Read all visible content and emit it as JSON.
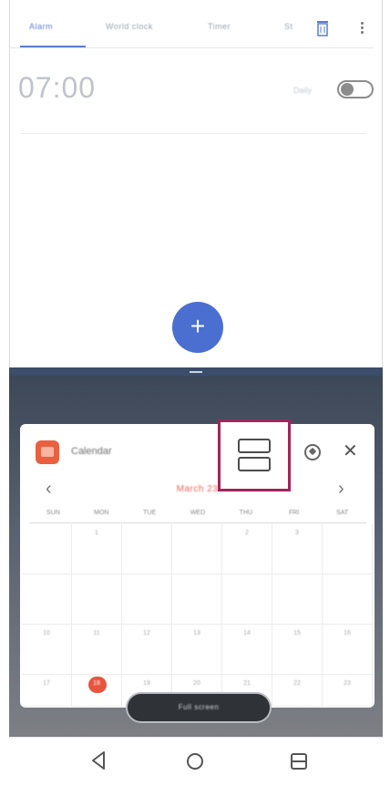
{
  "clock": {
    "tabs": [
      {
        "label": "Alarm",
        "active": true
      },
      {
        "label": "World clock",
        "active": false
      },
      {
        "label": "Timer",
        "active": false
      },
      {
        "label": "St",
        "active": false
      }
    ],
    "alarm": {
      "time": "07:00",
      "days": "Daily",
      "enabled": false
    },
    "icons": {
      "delete": "trash-icon",
      "more": "more-vert-icon",
      "add": "add-icon"
    },
    "accent": "#4a6fd0"
  },
  "split_divider": {
    "handle": "drag-handle"
  },
  "calendar_popup": {
    "app_name": "Calendar",
    "month_label": "March 23",
    "weekdays": [
      "SUN",
      "MON",
      "TUE",
      "WED",
      "THU",
      "FRI",
      "SAT"
    ],
    "weeks": [
      [
        "",
        "1",
        "",
        "",
        "2",
        "3",
        ""
      ],
      [
        "",
        "",
        "",
        "",
        "",
        "",
        ""
      ],
      [
        "10",
        "11",
        "12",
        "13",
        "14",
        "15",
        "16"
      ],
      [
        "17",
        "18",
        "19",
        "20",
        "21",
        "22",
        "23"
      ]
    ],
    "today_index": {
      "week": 3,
      "day": 1
    },
    "icons": {
      "split": "split-screen-icon",
      "compass": "compass-icon",
      "close": "close-icon",
      "prev": "chevron-left-icon",
      "next": "chevron-right-icon"
    },
    "highlight_color": "#a3235b",
    "today_color": "#e8553e"
  },
  "bottom_pill": {
    "label": "Full screen"
  },
  "navbar": {
    "back": "back-icon",
    "home": "home-icon",
    "recents": "recents-icon"
  }
}
